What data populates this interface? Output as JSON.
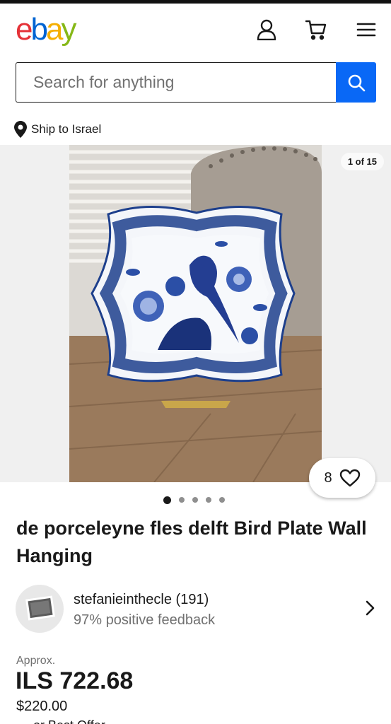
{
  "brand": {
    "logo_letters": [
      "e",
      "b",
      "a",
      "y"
    ],
    "logo_colors": [
      "#e53238",
      "#0064d2",
      "#f5af02",
      "#86b817"
    ]
  },
  "header": {
    "icons": [
      "user-icon",
      "cart-icon",
      "menu-icon"
    ]
  },
  "search": {
    "placeholder": "Search for anything",
    "value": "",
    "button_color": "#0968f6"
  },
  "shipping": {
    "label": "Ship to Israel"
  },
  "gallery": {
    "counter": "1 of 15",
    "current_image": 1,
    "total_images": 15,
    "visible_dots": 5,
    "active_dot": 0
  },
  "watch": {
    "count": "8"
  },
  "listing": {
    "title": "de porceleyne fles delft Bird Plate Wall Hanging"
  },
  "seller": {
    "name": "stefanieinthecle (191)",
    "feedback": "97% positive feedback"
  },
  "price": {
    "approx_label": "Approx.",
    "converted": "ILS 722.68",
    "original": "$220.00",
    "best_offer_partial": "or Best Offer"
  }
}
